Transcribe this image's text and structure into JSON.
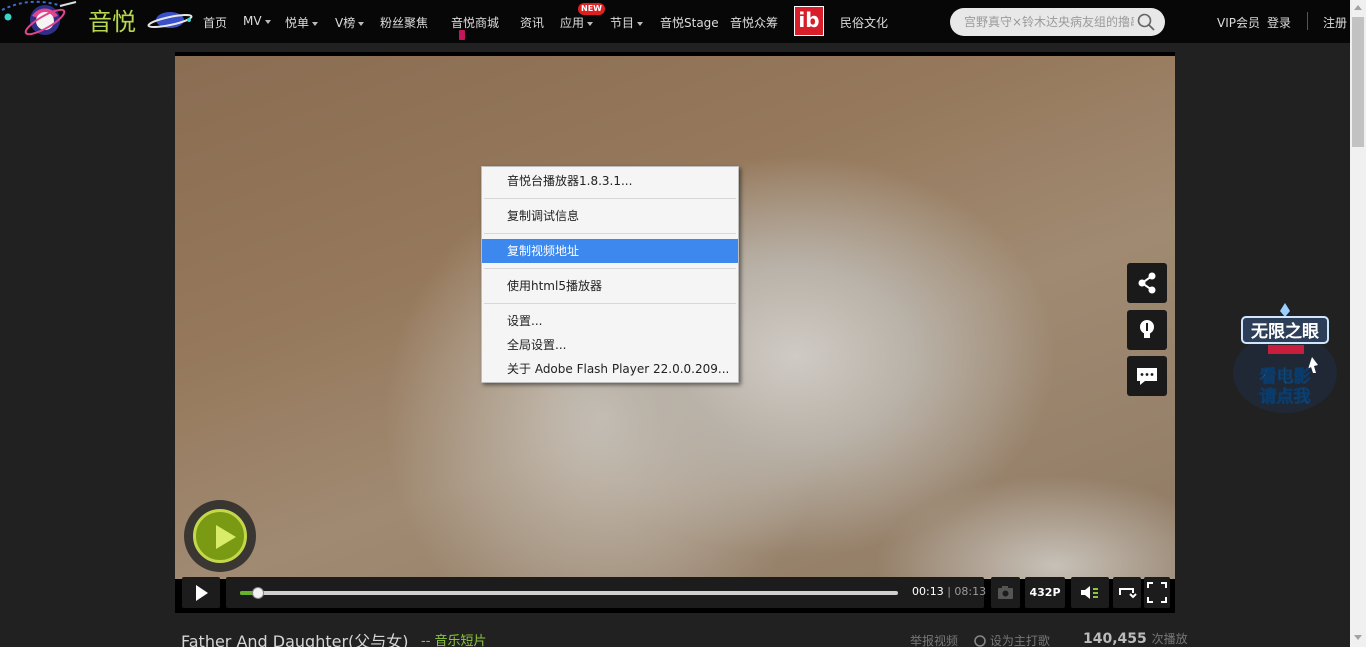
{
  "header": {
    "logo_text": "音悦",
    "nav": [
      {
        "label": "首页",
        "dropdown": false
      },
      {
        "label": "MV",
        "dropdown": true
      },
      {
        "label": "悦单",
        "dropdown": true
      },
      {
        "label": "V榜",
        "dropdown": true
      },
      {
        "label": "粉丝聚焦",
        "dropdown": false
      },
      {
        "label": "音悦商城",
        "dropdown": false
      },
      {
        "label": "资讯",
        "dropdown": false
      },
      {
        "label": "应用",
        "dropdown": true,
        "badge": "NEW"
      },
      {
        "label": "节目",
        "dropdown": true
      },
      {
        "label": "音悦Stage",
        "dropdown": false
      },
      {
        "label": "音悦众筹",
        "dropdown": false
      },
      {
        "label": "民俗文化",
        "dropdown": false
      }
    ],
    "brand_logo_text": "ib",
    "search_placeholder": "宫野真守×铃木达央病友组的撸串",
    "vip_label": "VIP会员",
    "login_label": "登录",
    "register_label": "注册"
  },
  "player": {
    "current_time": "00:13",
    "duration": "08:13",
    "progress": 0.027,
    "quality": "432P",
    "icons": [
      "play-icon",
      "camera-icon",
      "volume-icon",
      "loop-icon",
      "fullscreen-icon",
      "big-play-icon"
    ]
  },
  "context_menu": {
    "items": [
      {
        "label": "音悦台播放器1.8.3.1...",
        "highlighted": false
      },
      {
        "label": "复制调试信息",
        "highlighted": false
      },
      {
        "label": "复制视频地址",
        "highlighted": true
      },
      {
        "label": "使用html5播放器",
        "highlighted": false
      },
      {
        "label": "设置...",
        "highlighted": false
      },
      {
        "label": "全局设置...",
        "highlighted": false
      },
      {
        "label": "关于 Adobe Flash Player 22.0.0.209...",
        "highlighted": false
      }
    ]
  },
  "side_buttons": [
    "share-icon",
    "lightbulb-icon",
    "comment-icon"
  ],
  "ad": {
    "line1": "无限之眼",
    "line2": "看电影",
    "line3": "请点我"
  },
  "video_info": {
    "title": "Father And Daughter(父与女)",
    "category_prefix": "--",
    "category": "音乐短片",
    "report_label": "举报视频",
    "set_theme_label": "设为主打歌",
    "play_count": "140,455",
    "play_suffix": "次播放"
  },
  "colors": {
    "header_bg": "#070707",
    "page_bg": "#212121",
    "accent_green": "#8cc63e",
    "menu_highlight": "#3c88ee",
    "badge_red": "#e02020"
  }
}
